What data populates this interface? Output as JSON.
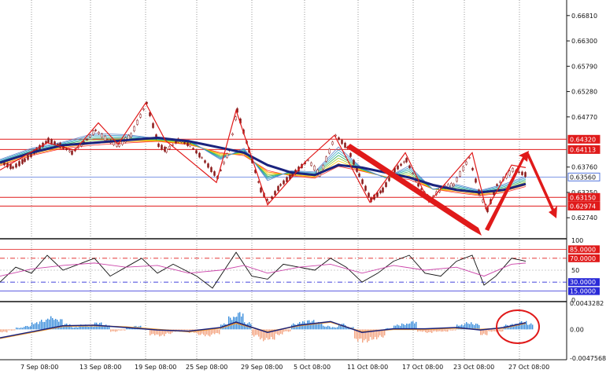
{
  "chart_data": [
    {
      "type": "line",
      "panel": "price",
      "y_ticks": [
        "0.66810",
        "0.66300",
        "0.65790",
        "0.65280",
        "0.64770",
        "0.63760",
        "0.63250",
        "0.62740"
      ],
      "ylim": [
        0.6238,
        0.6706
      ],
      "level_lines": [
        {
          "value": 0.6432,
          "label": "0.64320",
          "color": "#e01a1a"
        },
        {
          "value": 0.64113,
          "label": "0.64113",
          "color": "#e01a1a"
        },
        {
          "value": 0.6356,
          "label": "0.63560",
          "color": "#5577dd"
        },
        {
          "value": 0.6315,
          "label": "0.63150",
          "color": "#e01a1a"
        },
        {
          "value": 0.62974,
          "label": "0.62974",
          "color": "#e01a1a"
        }
      ],
      "x_labels": [
        "7 Sep 08:00",
        "13 Sep 08:00",
        "19 Sep 08:00",
        "25 Sep 08:00",
        "29 Sep 08:00",
        "5 Oct 08:00",
        "11 Oct 08:00",
        "17 Oct 08:00",
        "23 Oct 08:00",
        "27 Oct 08:00"
      ],
      "price_series": [
        [
          0,
          0.6385
        ],
        [
          15,
          0.6375
        ],
        [
          30,
          0.639
        ],
        [
          45,
          0.641
        ],
        [
          60,
          0.643
        ],
        [
          75,
          0.642
        ],
        [
          90,
          0.6405
        ],
        [
          105,
          0.6425
        ],
        [
          120,
          0.645
        ],
        [
          135,
          0.643
        ],
        [
          150,
          0.642
        ],
        [
          165,
          0.644
        ],
        [
          185,
          0.6505
        ],
        [
          200,
          0.642
        ],
        [
          210,
          0.641
        ],
        [
          225,
          0.643
        ],
        [
          240,
          0.642
        ],
        [
          255,
          0.6395
        ],
        [
          275,
          0.6355
        ],
        [
          290,
          0.641
        ],
        [
          300,
          0.649
        ],
        [
          315,
          0.641
        ],
        [
          330,
          0.633
        ],
        [
          340,
          0.6305
        ],
        [
          355,
          0.634
        ],
        [
          370,
          0.636
        ],
        [
          390,
          0.639
        ],
        [
          405,
          0.636
        ],
        [
          425,
          0.644
        ],
        [
          440,
          0.6415
        ],
        [
          455,
          0.636
        ],
        [
          470,
          0.631
        ],
        [
          485,
          0.633
        ],
        [
          500,
          0.637
        ],
        [
          515,
          0.639
        ],
        [
          530,
          0.634
        ],
        [
          545,
          0.631
        ],
        [
          560,
          0.6335
        ],
        [
          575,
          0.634
        ],
        [
          595,
          0.6395
        ],
        [
          608,
          0.632
        ],
        [
          618,
          0.629
        ],
        [
          630,
          0.634
        ],
        [
          650,
          0.637
        ],
        [
          668,
          0.636
        ]
      ],
      "ma_series": [
        [
          0,
          0.6385
        ],
        [
          40,
          0.6405
        ],
        [
          80,
          0.642
        ],
        [
          120,
          0.6425
        ],
        [
          160,
          0.643
        ],
        [
          200,
          0.6435
        ],
        [
          240,
          0.6428
        ],
        [
          280,
          0.6415
        ],
        [
          310,
          0.6405
        ],
        [
          340,
          0.638
        ],
        [
          370,
          0.6365
        ],
        [
          400,
          0.636
        ],
        [
          430,
          0.638
        ],
        [
          460,
          0.6375
        ],
        [
          490,
          0.6365
        ],
        [
          520,
          0.6355
        ],
        [
          550,
          0.634
        ],
        [
          580,
          0.633
        ],
        [
          610,
          0.6325
        ],
        [
          640,
          0.633
        ],
        [
          668,
          0.6342
        ]
      ],
      "zigzag": [
        [
          0,
          0.637
        ],
        [
          60,
          0.6425
        ],
        [
          95,
          0.641
        ],
        [
          125,
          0.6465
        ],
        [
          150,
          0.6422
        ],
        [
          185,
          0.6505
        ],
        [
          210,
          0.643
        ],
        [
          275,
          0.6345
        ],
        [
          300,
          0.649
        ],
        [
          340,
          0.63
        ],
        [
          390,
          0.639
        ],
        [
          425,
          0.644
        ],
        [
          470,
          0.6305
        ],
        [
          515,
          0.6405
        ],
        [
          545,
          0.6305
        ],
        [
          600,
          0.6405
        ],
        [
          618,
          0.629
        ],
        [
          650,
          0.638
        ],
        [
          668,
          0.6375
        ]
      ]
    },
    {
      "type": "line",
      "panel": "oscillator",
      "y_ticks": [
        "100",
        "50",
        "0"
      ],
      "ylim": [
        0,
        100
      ],
      "level_lines": [
        {
          "value": 85,
          "label": "85.0000",
          "color": "#e01a1a"
        },
        {
          "value": 70,
          "label": "70.0000",
          "color": "#e01a1a"
        },
        {
          "value": 30,
          "label": "30.0000",
          "color": "#2a2ad8"
        },
        {
          "value": 15,
          "label": "15.0000",
          "color": "#2a2ad8"
        }
      ],
      "series": [
        {
          "color": "#111111",
          "values": [
            [
              0,
              30
            ],
            [
              20,
              55
            ],
            [
              40,
              45
            ],
            [
              60,
              75
            ],
            [
              80,
              50
            ],
            [
              100,
              60
            ],
            [
              120,
              70
            ],
            [
              140,
              40
            ],
            [
              160,
              55
            ],
            [
              180,
              70
            ],
            [
              200,
              45
            ],
            [
              220,
              60
            ],
            [
              250,
              40
            ],
            [
              270,
              20
            ],
            [
              290,
              60
            ],
            [
              300,
              80
            ],
            [
              320,
              40
            ],
            [
              340,
              35
            ],
            [
              360,
              60
            ],
            [
              380,
              55
            ],
            [
              400,
              50
            ],
            [
              420,
              70
            ],
            [
              440,
              55
            ],
            [
              460,
              30
            ],
            [
              480,
              45
            ],
            [
              500,
              65
            ],
            [
              520,
              75
            ],
            [
              540,
              45
            ],
            [
              560,
              40
            ],
            [
              580,
              65
            ],
            [
              600,
              75
            ],
            [
              615,
              25
            ],
            [
              630,
              40
            ],
            [
              650,
              70
            ],
            [
              668,
              65
            ]
          ]
        },
        {
          "color": "#cc44aa",
          "values": [
            [
              0,
              40
            ],
            [
              40,
              52
            ],
            [
              80,
              58
            ],
            [
              120,
              62
            ],
            [
              160,
              55
            ],
            [
              200,
              58
            ],
            [
              240,
              45
            ],
            [
              280,
              50
            ],
            [
              310,
              58
            ],
            [
              340,
              45
            ],
            [
              380,
              55
            ],
            [
              420,
              60
            ],
            [
              460,
              45
            ],
            [
              500,
              58
            ],
            [
              540,
              50
            ],
            [
              580,
              55
            ],
            [
              615,
              40
            ],
            [
              650,
              60
            ],
            [
              668,
              62
            ]
          ]
        }
      ]
    },
    {
      "type": "bar",
      "panel": "macd",
      "y_ticks": [
        "0.0043282",
        "0.00",
        "-0.0047568"
      ],
      "ylim": [
        -0.0047568,
        0.0043282
      ],
      "bars": [
        [
          0,
          -0.0005
        ],
        [
          10,
          -0.0002
        ],
        [
          20,
          0.0003
        ],
        [
          30,
          0.0006
        ],
        [
          40,
          0.0012
        ],
        [
          50,
          0.0016
        ],
        [
          60,
          0.0022
        ],
        [
          70,
          0.0018
        ],
        [
          80,
          0.001
        ],
        [
          90,
          0.0004
        ],
        [
          100,
          0.0008
        ],
        [
          110,
          0.0006
        ],
        [
          120,
          0.0012
        ],
        [
          130,
          0.0008
        ],
        [
          140,
          -0.0004
        ],
        [
          150,
          -0.0002
        ],
        [
          160,
          0.0004
        ],
        [
          170,
          0.0006
        ],
        [
          180,
          0.0002
        ],
        [
          190,
          -0.001
        ],
        [
          200,
          -0.0012
        ],
        [
          210,
          -0.0008
        ],
        [
          220,
          -0.0004
        ],
        [
          230,
          -0.0002
        ],
        [
          240,
          -0.0006
        ],
        [
          250,
          -0.001
        ],
        [
          260,
          -0.0012
        ],
        [
          270,
          -0.0008
        ],
        [
          280,
          0.001
        ],
        [
          290,
          0.0022
        ],
        [
          300,
          0.003
        ],
        [
          310,
          0.0012
        ],
        [
          320,
          -0.0012
        ],
        [
          330,
          -0.002
        ],
        [
          340,
          -0.0018
        ],
        [
          350,
          -0.001
        ],
        [
          360,
          -0.0004
        ],
        [
          370,
          0.001
        ],
        [
          380,
          0.0014
        ],
        [
          390,
          0.0016
        ],
        [
          400,
          0.0012
        ],
        [
          410,
          0.0006
        ],
        [
          420,
          0.0004
        ],
        [
          430,
          0.001
        ],
        [
          440,
          0.0004
        ],
        [
          450,
          -0.002
        ],
        [
          460,
          -0.0022
        ],
        [
          470,
          -0.0018
        ],
        [
          480,
          -0.0014
        ],
        [
          490,
          0.0002
        ],
        [
          500,
          0.0008
        ],
        [
          510,
          0.001
        ],
        [
          520,
          0.0014
        ],
        [
          530,
          -0.0004
        ],
        [
          540,
          -0.0006
        ],
        [
          550,
          -0.0004
        ],
        [
          560,
          -0.0004
        ],
        [
          570,
          -0.0002
        ],
        [
          580,
          0.0008
        ],
        [
          590,
          0.0012
        ],
        [
          600,
          0.001
        ],
        [
          610,
          -0.001
        ],
        [
          620,
          -0.0004
        ],
        [
          630,
          -0.0004
        ],
        [
          640,
          0.0008
        ],
        [
          650,
          0.001
        ],
        [
          660,
          0.0014
        ],
        [
          668,
          0.001
        ]
      ],
      "signal": [
        [
          0,
          -0.0015
        ],
        [
          40,
          -0.0005
        ],
        [
          80,
          0.0005
        ],
        [
          120,
          0.0006
        ],
        [
          160,
          0.0004
        ],
        [
          200,
          0.0
        ],
        [
          240,
          -0.0004
        ],
        [
          280,
          0.0002
        ],
        [
          300,
          0.001
        ],
        [
          340,
          -0.0004
        ],
        [
          380,
          0.0006
        ],
        [
          420,
          0.0012
        ],
        [
          460,
          -0.0004
        ],
        [
          500,
          0.0
        ],
        [
          540,
          0.0
        ],
        [
          580,
          0.0002
        ],
        [
          610,
          0.0
        ],
        [
          640,
          0.0002
        ],
        [
          668,
          0.001
        ]
      ],
      "macd_line": [
        [
          0,
          -0.0014
        ],
        [
          40,
          -0.0004
        ],
        [
          80,
          0.0006
        ],
        [
          120,
          0.0007
        ],
        [
          160,
          0.0003
        ],
        [
          200,
          -0.0001
        ],
        [
          240,
          -0.0003
        ],
        [
          280,
          0.0003
        ],
        [
          300,
          0.0012
        ],
        [
          340,
          -0.0005
        ],
        [
          380,
          0.0007
        ],
        [
          420,
          0.0013
        ],
        [
          460,
          -0.0005
        ],
        [
          500,
          0.0001
        ],
        [
          540,
          0.0001
        ],
        [
          580,
          0.0003
        ],
        [
          610,
          -0.0001
        ],
        [
          640,
          0.0003
        ],
        [
          668,
          0.0011
        ]
      ]
    }
  ]
}
